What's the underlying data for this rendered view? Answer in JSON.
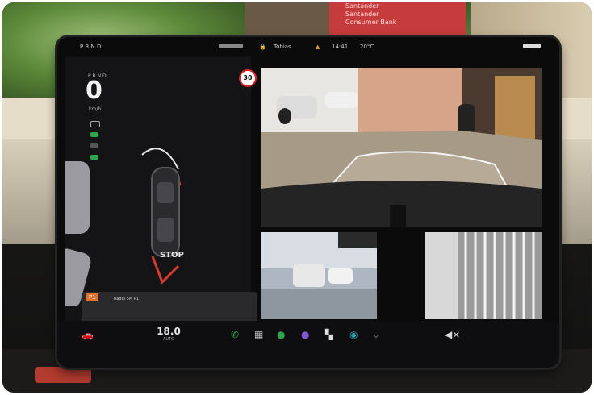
{
  "background": {
    "sign_lines": [
      "Santander",
      "Santander",
      "Consumer Bank"
    ]
  },
  "status_bar": {
    "prnd": "P R N D",
    "lock": "🔒",
    "user": "Tobias",
    "time": "14:41",
    "temp": "20°C"
  },
  "driving": {
    "speed": "0",
    "unit": "km/h",
    "speed_limit": "30",
    "stop_label": "STOP"
  },
  "media": {
    "source_badge": "P1",
    "track": "Radio 5M P1"
  },
  "dock": {
    "cabin_temp": "18.0",
    "temp_caption": "AUTO"
  },
  "colors": {
    "accent_red": "#d63a2b",
    "speed_limit_ring": "#dd2222",
    "media_badge": "#e2702e"
  }
}
